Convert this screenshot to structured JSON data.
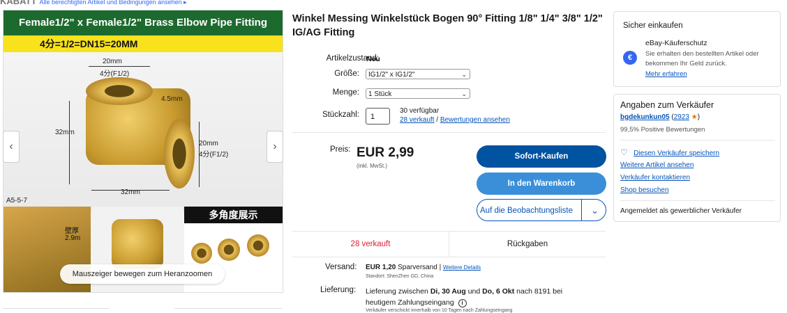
{
  "top_strip": {
    "prefix": "KABATT",
    "text": "Alle berechtigten Artikel und Bedingungen ansehen ▸"
  },
  "gallery": {
    "banner": "Female1/2\" x Female1/2\" Brass Elbow Pipe Fitting",
    "spec": "4分=1/2=DN15=20MM",
    "dim_top": "20mm",
    "dim_top_sub": "4分(F1/2)",
    "dim_wall": "4.5mm",
    "dim_left": "32mm",
    "dim_right": "20mm",
    "dim_right_sub": "4分(F1/2)",
    "dim_bottom": "32mm",
    "code": "A5-5-7",
    "wall_label": "壁厚",
    "wall_value": "2.9m",
    "multi_angle": "多角度展示",
    "zoom_tip": "Mauszeiger bewegen zum Heranzoomen",
    "prev": "‹",
    "next": "›"
  },
  "product": {
    "title": "Winkel Messing Winkelstück Bogen 90° Fitting 1/8\" 1/4\" 3/8\" 1/2\" IG/AG Fitting",
    "condition_label": "Artikelzustand:",
    "condition_value": "Neu",
    "size_label": "Größe:",
    "size_value": "IG1/2\" x IG1/2\"",
    "amount_label": "Menge:",
    "amount_value": "1 Stück",
    "qty_label": "Stückzahl:",
    "qty_value": "1",
    "available": "30 verfügbar",
    "sold_link": "28 verkauft",
    "slash": "/",
    "reviews_link": "Bewertungen ansehen"
  },
  "price": {
    "label": "Preis:",
    "value": "EUR 2,99",
    "vat": "(inkl. MwSt.)"
  },
  "buttons": {
    "buy_now": "Sofort-Kaufen",
    "add_to_cart": "In den Warenkorb",
    "watchlist": "Auf die Beobachtungsliste",
    "watch_chevron": "⌄"
  },
  "stats": {
    "sold": "28 verkauft",
    "returns": "Rückgaben"
  },
  "shipping": {
    "label": "Versand:",
    "value": "EUR 1,20",
    "method": "Sparversand",
    "sep": "|",
    "details_link": "Weitere Details",
    "location": "Standort: ShenZhen GD, China",
    "delivery_label": "Lieferung:",
    "delivery_text_1": "Lieferung zwischen",
    "delivery_date_1": "Di, 30 Aug",
    "delivery_text_2": "und",
    "delivery_date_2": "Do, 6 Okt",
    "delivery_text_3": "nach 8191 bei heutigem Zahlungseingang",
    "info_icon": "i",
    "cut_text": "Verkäufer verschickt innerhalb von 10 Tagen nach Zahlungseingang"
  },
  "secure": {
    "title": "Sicher einkaufen",
    "protection_title": "eBay-Käuferschutz",
    "protection_text": "Sie erhalten den bestellten Artikel oder bekommen Ihr Geld zurück.",
    "more_link": "Mehr erfahren",
    "shield_symbol": "€"
  },
  "seller": {
    "title": "Angaben zum Verkäufer",
    "name": "bgdekunkun05",
    "count": "2923",
    "star": "★",
    "positive": "99,5% Positive Bewertungen",
    "save_link": "Diesen Verkäufer speichern",
    "heart": "♡",
    "more_items": "Weitere Artikel ansehen",
    "contact": "Verkäufer kontaktieren",
    "shop": "Shop besuchen",
    "business": "Angemeldet als gewerblicher Verkäufer"
  },
  "colors": {
    "buy": "#0053a0",
    "cart": "#3b8fd9",
    "link": "#0654ba",
    "sold_red": "#dd1e31"
  }
}
